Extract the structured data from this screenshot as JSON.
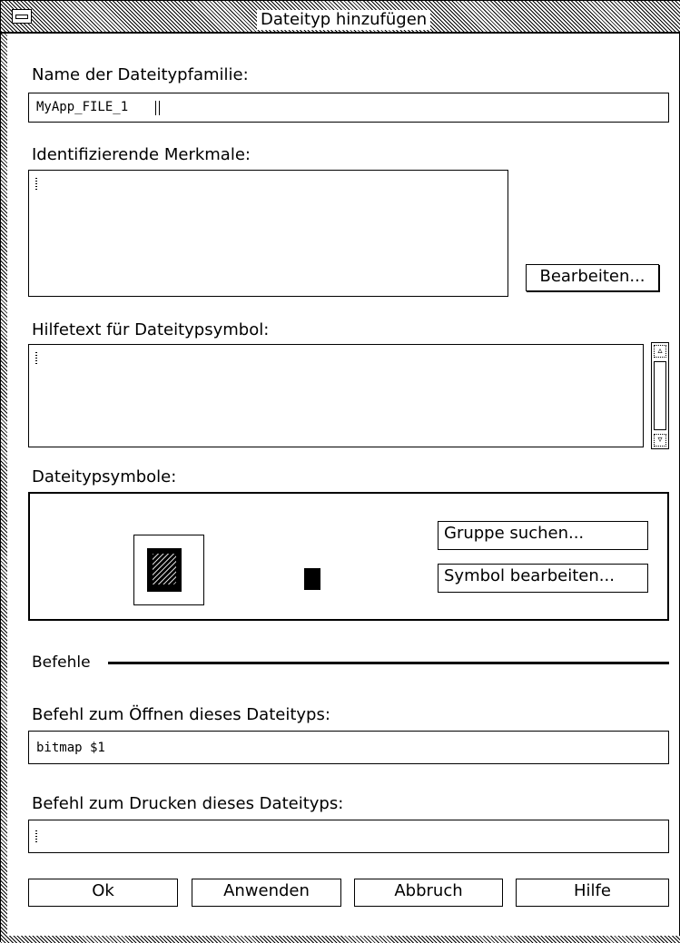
{
  "window": {
    "title": "Dateityp hinzufügen"
  },
  "family_name": {
    "label": "Name der Dateitypfamilie:",
    "value": "MyApp_FILE_1"
  },
  "identifying": {
    "label": "Identifizierende Merkmale:",
    "edit_button": "Bearbeiten..."
  },
  "help_text": {
    "label": "Hilfetext für Dateitypsymbol:"
  },
  "icons": {
    "label": "Dateitypsymbole:",
    "find_set_button": "Gruppe suchen...",
    "edit_icon_button": "Symbol bearbeiten..."
  },
  "commands": {
    "section_label": "Befehle",
    "open_label": "Befehl zum Öffnen dieses Dateityps:",
    "open_value": "bitmap $1",
    "print_label": "Befehl zum Drucken dieses Dateityps:",
    "print_value": ""
  },
  "buttons": {
    "ok": "Ok",
    "apply": "Anwenden",
    "cancel": "Abbruch",
    "help": "Hilfe"
  }
}
